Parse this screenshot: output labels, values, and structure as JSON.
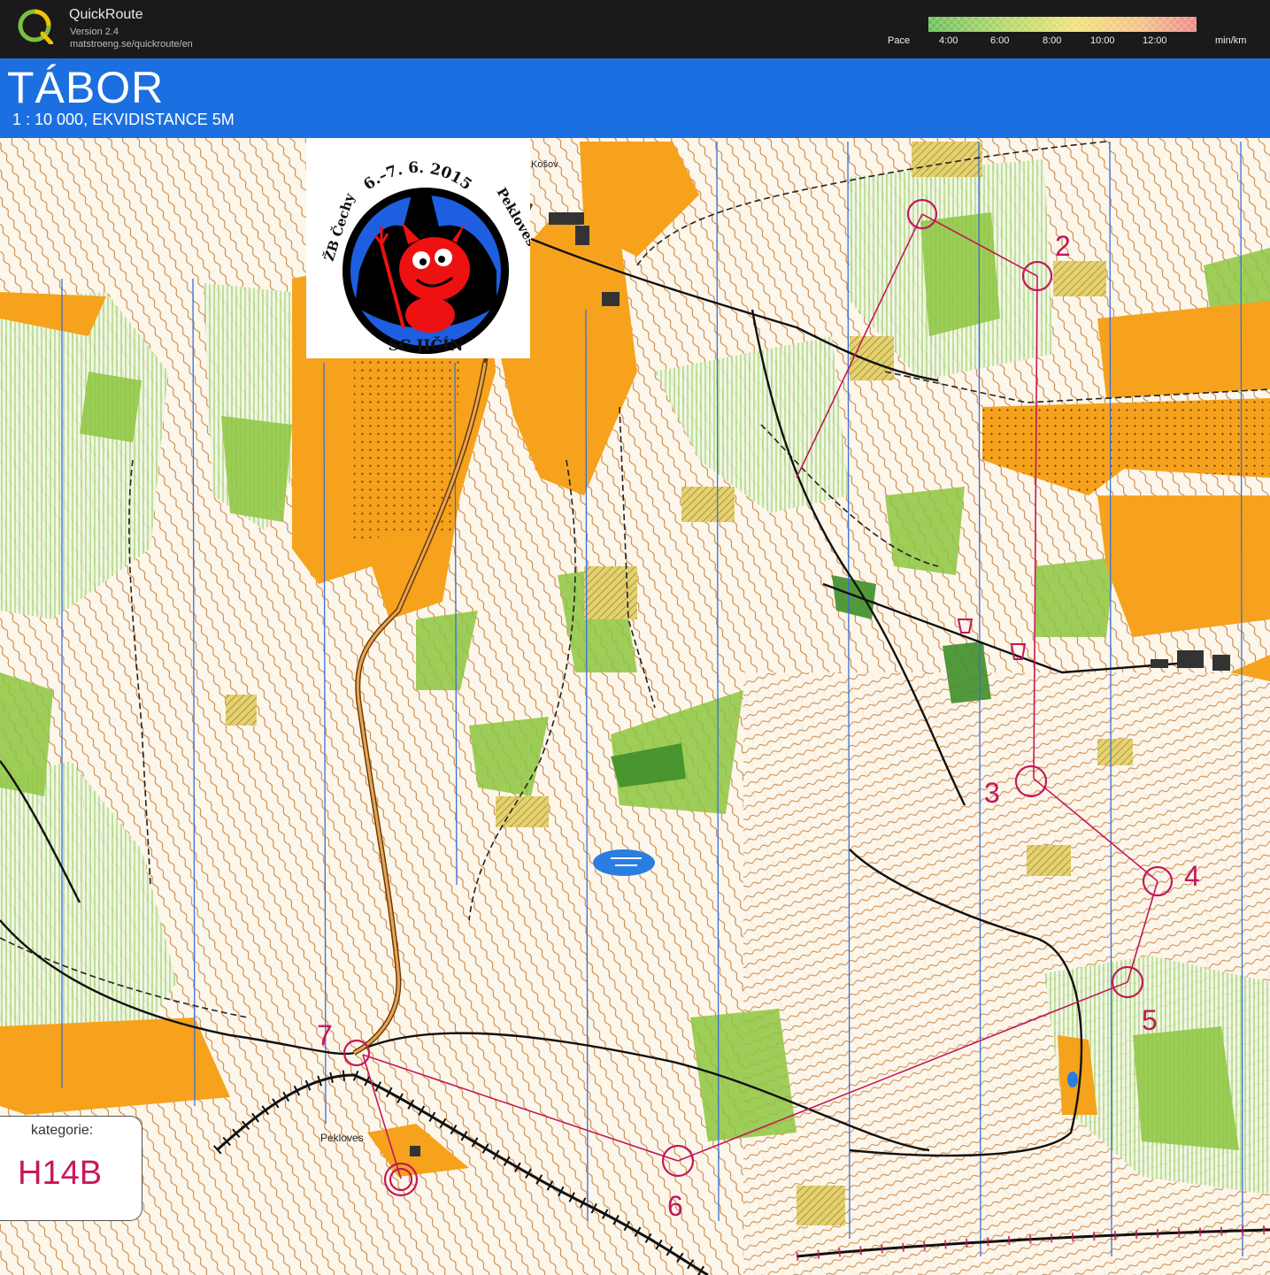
{
  "app": {
    "name": "QuickRoute",
    "version": "Version 2.4",
    "url": "matstroeng.se/quickroute/en"
  },
  "pace_legend": {
    "label": "Pace",
    "ticks": [
      "4:00",
      "6:00",
      "8:00",
      "10:00",
      "12:00"
    ],
    "unit": "min/km",
    "colors": [
      "#5cb85c",
      "#a8d060",
      "#f0e060",
      "#f5c060",
      "#f08080"
    ]
  },
  "map": {
    "title": "TÁBOR",
    "scale_text": "1 : 10 000, EKVIDISTANCE 5M",
    "places": {
      "kosov": "Košov",
      "pekloves": "Pekloves"
    },
    "category_label": "kategorie:",
    "category_value": "H14B",
    "controls": [
      "2",
      "3",
      "4",
      "5",
      "6",
      "7"
    ],
    "colors": {
      "header_blue": "#1c6fe0",
      "open_land": "#f6a21c",
      "forest_green": "#8dc63f",
      "contour_brown": "#b5651d",
      "course_magenta": "#c2185b",
      "north_line": "#3a6fd8"
    }
  },
  "badge": {
    "top_text": "6.–7. 6. 2015",
    "left_text": "ŽB Čechy",
    "right_text": "Pekloves",
    "bottom_text": "SC JIČÍN"
  }
}
